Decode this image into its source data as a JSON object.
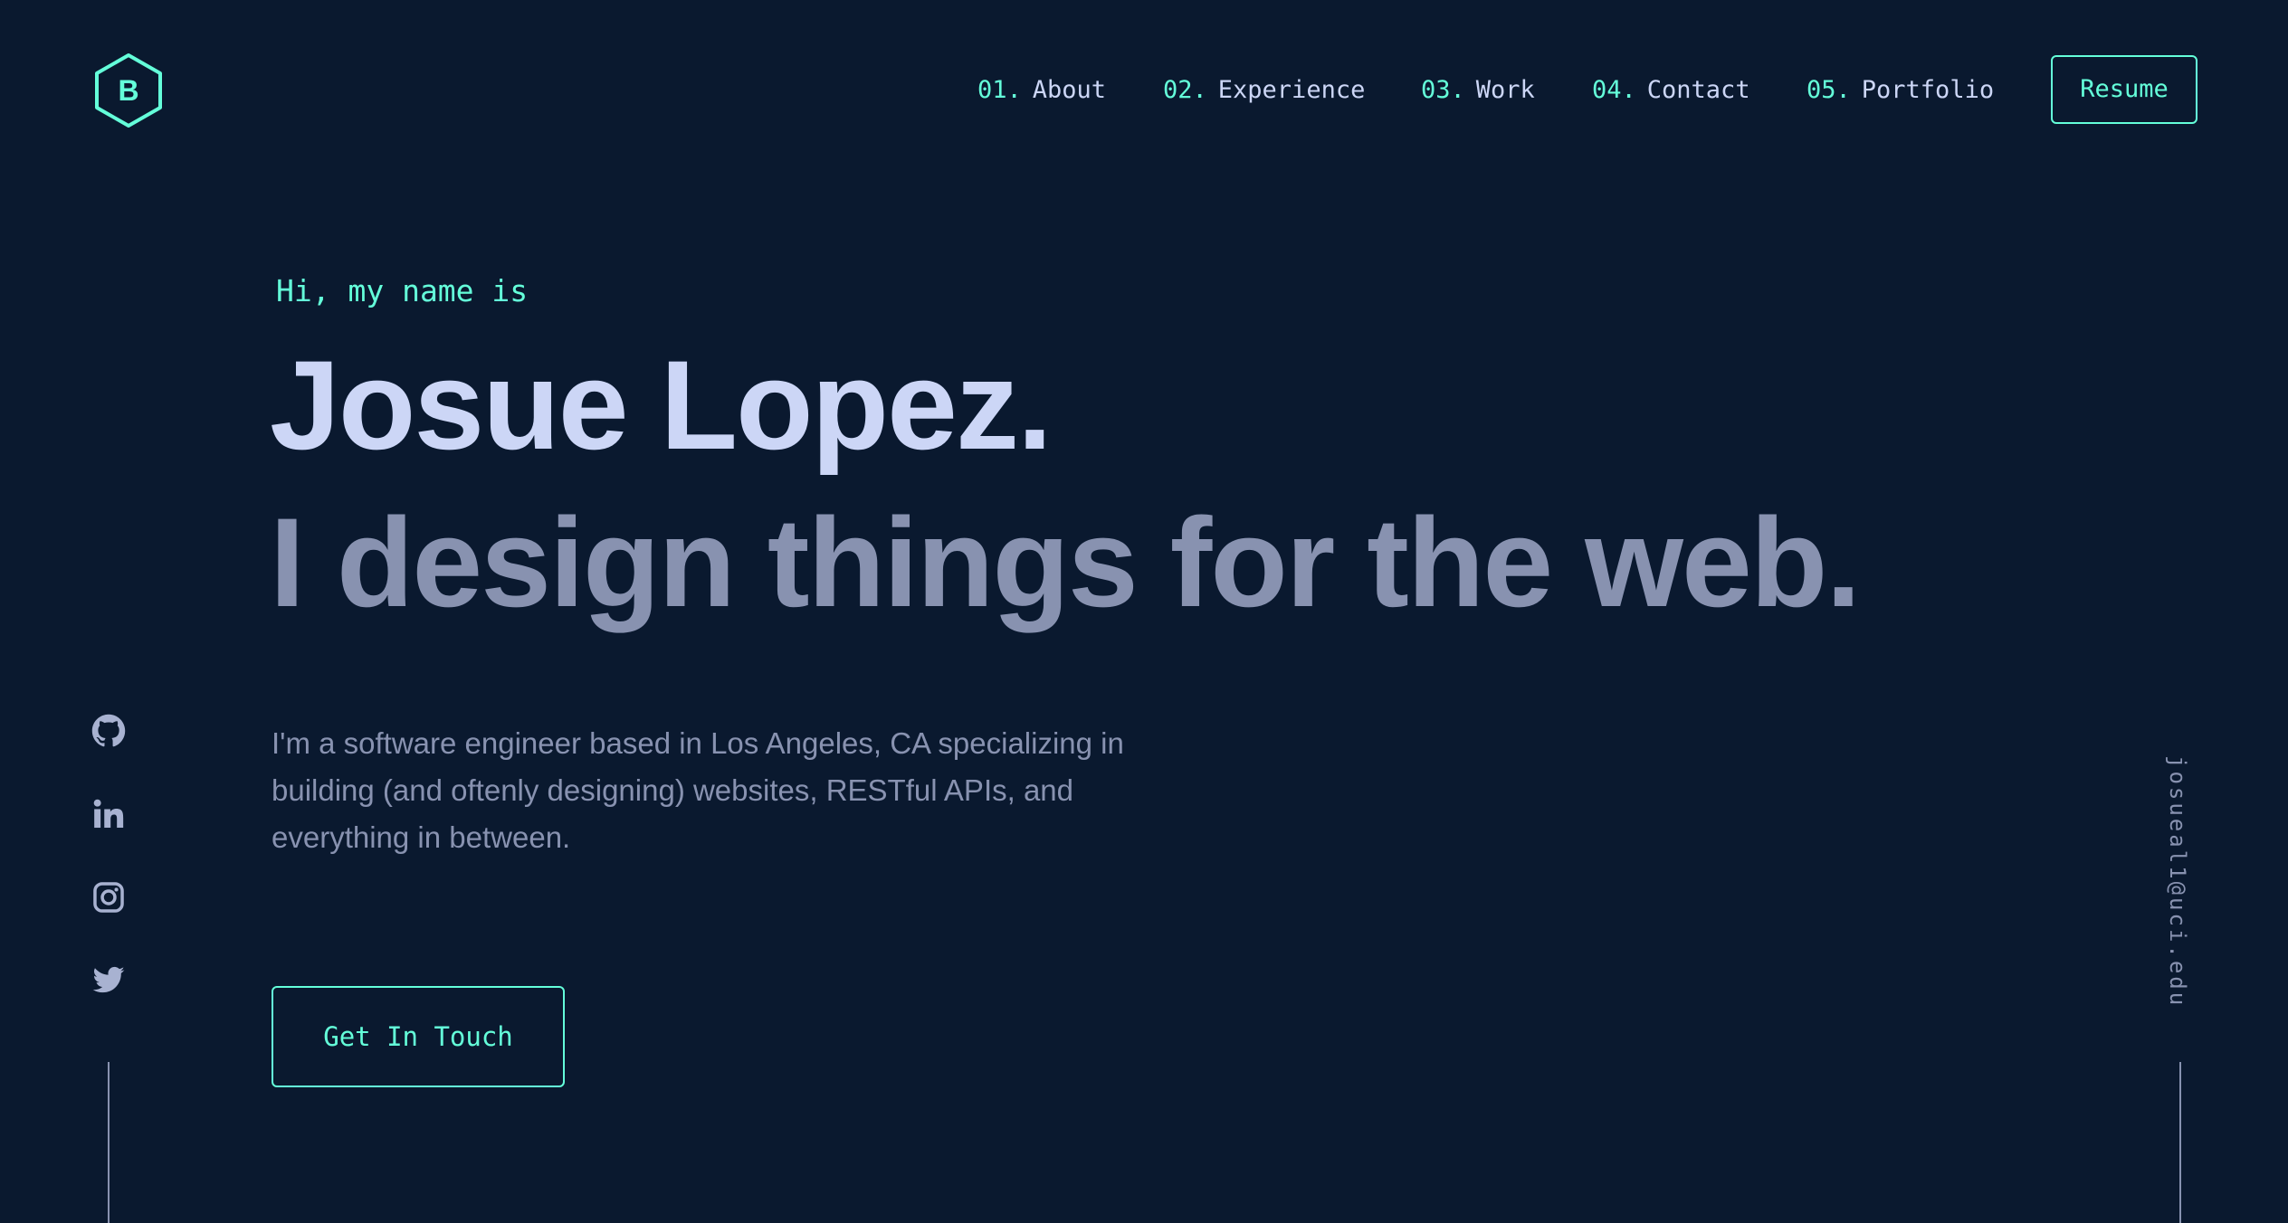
{
  "header": {
    "logo_letter": "B",
    "nav": [
      {
        "num": "01.",
        "label": "About"
      },
      {
        "num": "02.",
        "label": "Experience"
      },
      {
        "num": "03.",
        "label": "Work"
      },
      {
        "num": "04.",
        "label": "Contact"
      },
      {
        "num": "05.",
        "label": "Portfolio"
      }
    ],
    "resume_label": "Resume"
  },
  "hero": {
    "greeting": "Hi, my name is",
    "name": "Josue Lopez.",
    "tagline": "I design things for the web.",
    "intro": "I'm a software engineer based in Los Angeles, CA specializing in building (and oftenly designing) websites, RESTful APIs, and everything in between.",
    "cta_label": "Get In Touch"
  },
  "social": {
    "icons": [
      "github-icon",
      "linkedin-icon",
      "instagram-icon",
      "twitter-icon"
    ]
  },
  "email": "josueal1@uci.edu",
  "colors": {
    "background": "#0a192f",
    "accent": "#64ffda",
    "heading": "#ccd6f6",
    "text": "#8892b0"
  }
}
